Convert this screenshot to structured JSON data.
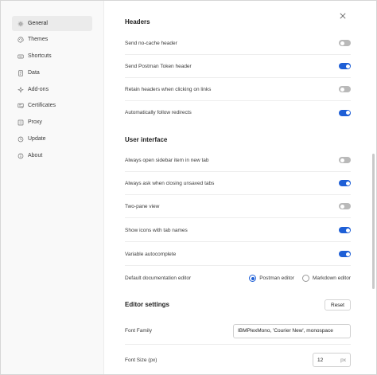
{
  "sidebar": {
    "items": [
      {
        "label": "General",
        "icon": "gear-icon",
        "active": true
      },
      {
        "label": "Themes",
        "icon": "palette-icon",
        "active": false
      },
      {
        "label": "Shortcuts",
        "icon": "keyboard-icon",
        "active": false
      },
      {
        "label": "Data",
        "icon": "database-icon",
        "active": false
      },
      {
        "label": "Add-ons",
        "icon": "plugin-icon",
        "active": false
      },
      {
        "label": "Certificates",
        "icon": "certificate-icon",
        "active": false
      },
      {
        "label": "Proxy",
        "icon": "proxy-icon",
        "active": false
      },
      {
        "label": "Update",
        "icon": "update-icon",
        "active": false
      },
      {
        "label": "About",
        "icon": "info-icon",
        "active": false
      }
    ]
  },
  "headers": {
    "title": "Headers",
    "rows": [
      {
        "label": "Send no-cache header",
        "on": false
      },
      {
        "label": "Send Postman Token header",
        "on": true
      },
      {
        "label": "Retain headers when clicking on links",
        "on": false
      },
      {
        "label": "Automatically follow redirects",
        "on": true
      }
    ]
  },
  "user_interface": {
    "title": "User interface",
    "rows": [
      {
        "label": "Always open sidebar item in new tab",
        "on": false
      },
      {
        "label": "Always ask when closing unsaved tabs",
        "on": true
      },
      {
        "label": "Two-pane view",
        "on": false
      },
      {
        "label": "Show icons with tab names",
        "on": true
      },
      {
        "label": "Variable autocomplete",
        "on": true
      }
    ],
    "doc_editor": {
      "label": "Default documentation editor",
      "options": [
        "Postman editor",
        "Markdown editor"
      ],
      "selected": "Postman editor"
    }
  },
  "editor_settings": {
    "title": "Editor settings",
    "reset_label": "Reset",
    "font_family": {
      "label": "Font Family",
      "value": "IBMPlexMono, 'Courier New', monospace"
    },
    "font_size": {
      "label": "Font Size (px)",
      "value": "12",
      "unit": "px"
    }
  },
  "colors": {
    "accent": "#1e5fd6",
    "toggle_off": "#b9b9b9",
    "sidebar_bg": "#f9f9f9",
    "active_item_bg": "#ebebeb"
  }
}
